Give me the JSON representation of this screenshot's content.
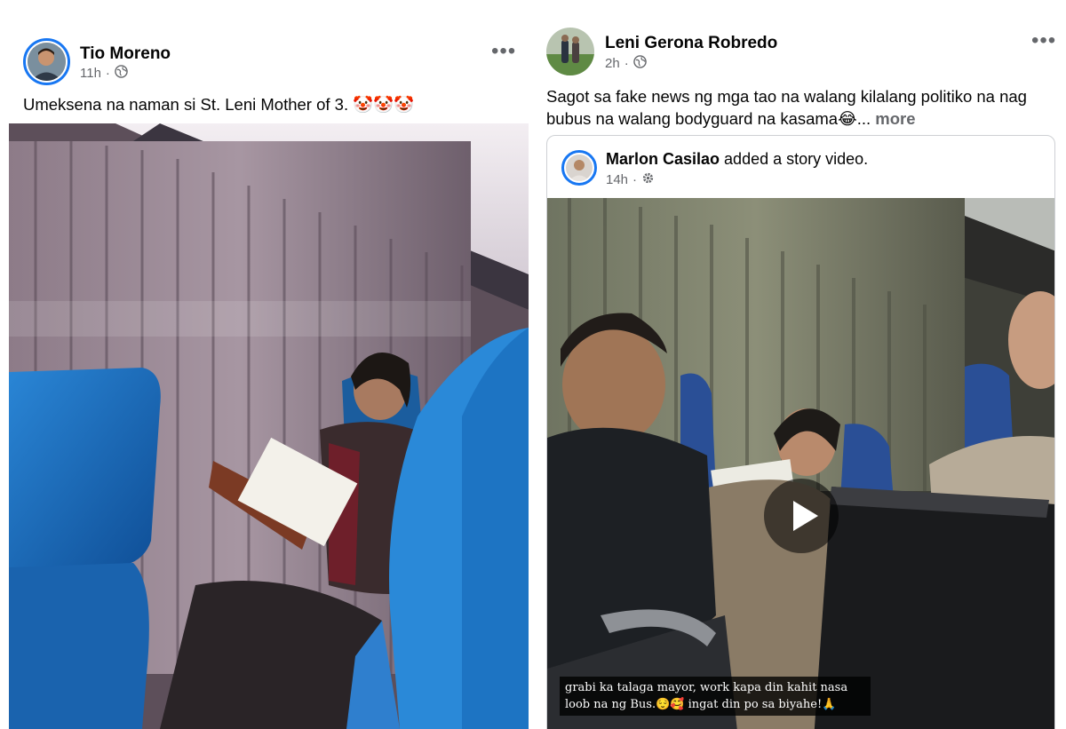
{
  "left_post": {
    "author": "Tio Moreno",
    "time": "11h",
    "separator": "·",
    "audience_icon": "globe-icon",
    "caption": "Umeksena na naman si St. Leni Mother of 3. 🤡🤡🤡",
    "menu_label": "•••",
    "image_description": "photo-bus-interior"
  },
  "right_post": {
    "author": "Leni Gerona Robredo",
    "time": "2h",
    "separator": "·",
    "audience_icon": "globe-icon",
    "caption": "Sagot sa fake news ng mga tao na walang kilalang politiko na nag bubus na walang bodyguard na kasama😂...",
    "see_more": "more",
    "menu_label": "•••",
    "shared": {
      "author": "Marlon Casilao",
      "action": "added a story video.",
      "time": "14h",
      "separator": "·",
      "audience_icon": "gear-icon",
      "video_subtitle": "grabi ka talaga mayor, work kapa din kahit nasa loob na ng Bus.😌🥰 ingat din po sa biyahe!🙏"
    }
  },
  "colors": {
    "brand_blue": "#1877f2",
    "secondary_text": "#65676b",
    "seat_blue": "#1e6fb8"
  }
}
